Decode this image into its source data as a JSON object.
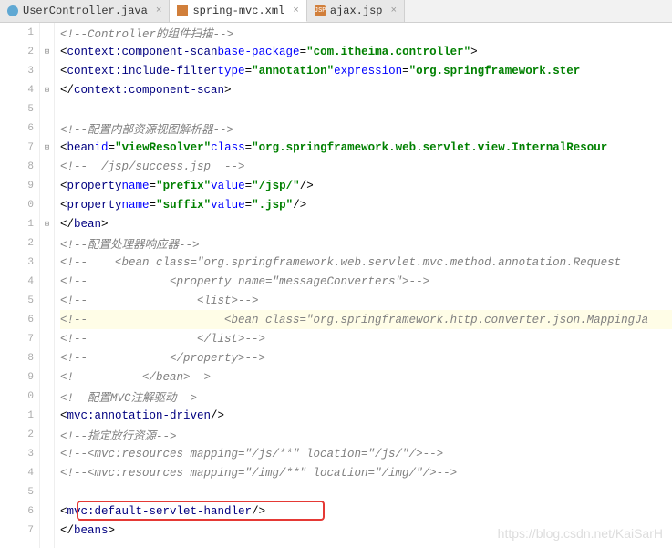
{
  "tabs": [
    {
      "label": "UserController.java",
      "active": false,
      "icon": "java"
    },
    {
      "label": "spring-mvc.xml",
      "active": true,
      "icon": "xml"
    },
    {
      "label": "ajax.jsp",
      "active": false,
      "icon": "jsp"
    }
  ],
  "gutter": [
    "1",
    "2",
    "3",
    "4",
    "5",
    "6",
    "7",
    "8",
    "9",
    "0",
    "1",
    "2",
    "3",
    "4",
    "5",
    "6",
    "7",
    "8",
    "9",
    "0",
    "1",
    "2",
    "3",
    "4",
    "5",
    "6",
    "7"
  ],
  "code": {
    "l1": "<!--Controller的组件扫描-->",
    "l2": {
      "tag": "context:component-scan",
      "attr1": "base-package",
      "val1": "com.itheima.controller"
    },
    "l3": {
      "tag": "context:include-filter",
      "attr1": "type",
      "val1": "annotation",
      "attr2": "expression",
      "val2": "org.springframework.ster"
    },
    "l4": {
      "tag": "context:component-scan"
    },
    "l6": "<!--配置内部资源视图解析器-->",
    "l7": {
      "tag": "bean",
      "attr1": "id",
      "val1": "viewResolver",
      "attr2": "class",
      "val2": "org.springframework.web.servlet.view.InternalResour"
    },
    "l8": "<!--  /jsp/success.jsp  -->",
    "l9": {
      "tag": "property",
      "attr1": "name",
      "val1": "prefix",
      "attr2": "value",
      "val2": "/jsp/"
    },
    "l10": {
      "tag": "property",
      "attr1": "name",
      "val1": "suffix",
      "attr2": "value",
      "val2": ".jsp"
    },
    "l11": {
      "tag": "bean"
    },
    "l12": "<!--配置处理器响应器-->",
    "l13": "<!--    <bean class=\"org.springframework.web.servlet.mvc.method.annotation.Request",
    "l14": "<!--            <property name=\"messageConverters\">-->",
    "l15": "<!--                <list>-->",
    "l16": "<!--                    <bean class=\"org.springframework.http.converter.json.MappingJa",
    "l17": "<!--                </list>-->",
    "l18": "<!--            </property>-->",
    "l19": "<!--        </bean>-->",
    "l20": "<!--配置MVC注解驱动-->",
    "l21": {
      "tag": "mvc:annotation-driven"
    },
    "l22": "<!--指定放行资源-->",
    "l23": "<!--<mvc:resources mapping=\"/js/**\" location=\"/js/\"/>-->",
    "l24": "<!--<mvc:resources mapping=\"/img/**\" location=\"/img/\"/>-->",
    "l26": {
      "tag": "mvc:default-servlet-handler"
    },
    "l27": {
      "tag": "beans"
    }
  },
  "watermark": "https://blog.csdn.net/KaiSarH"
}
